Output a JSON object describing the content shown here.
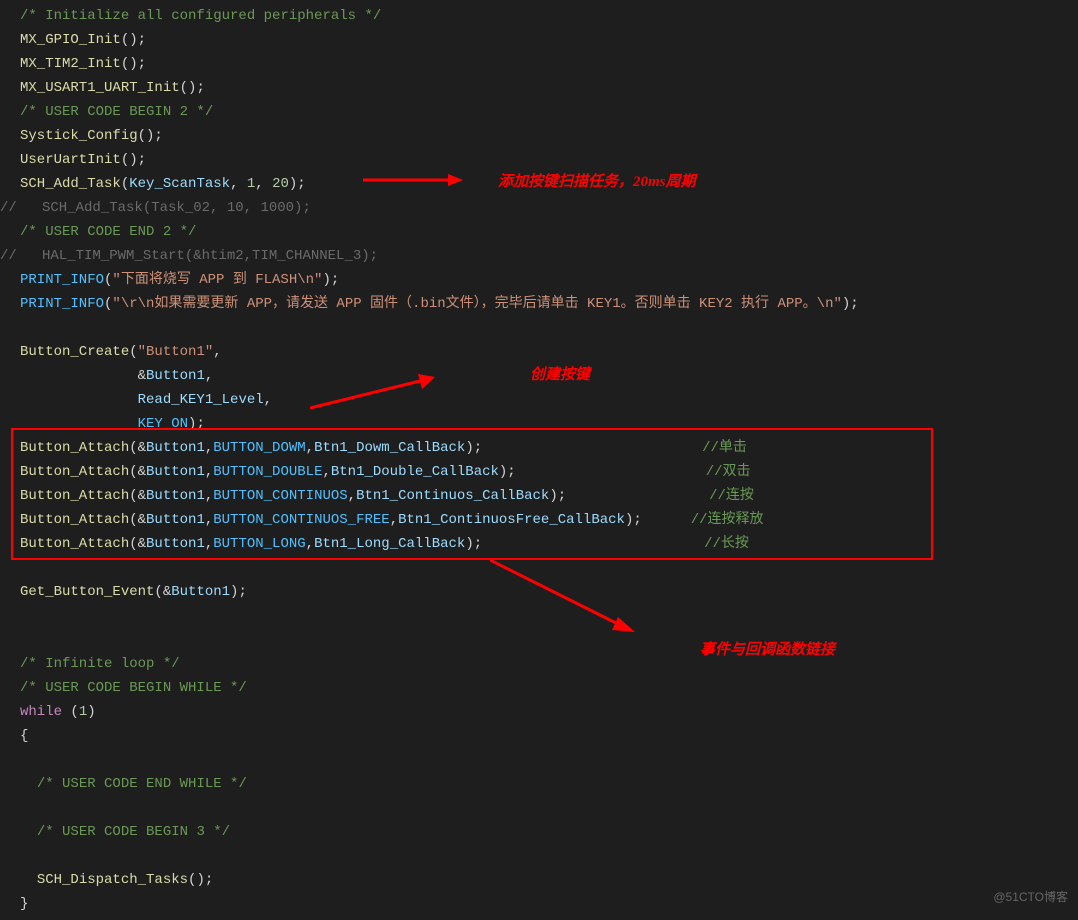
{
  "lines": {
    "l1": "/* Initialize all configured peripherals */",
    "l2a": "MX_GPIO_Init",
    "l2b": "();",
    "l3a": "MX_TIM2_Init",
    "l3b": "();",
    "l4a": "MX_USART1_UART_Init",
    "l4b": "();",
    "l5": "/* USER CODE BEGIN 2 */",
    "l6a": "Systick_Config",
    "l6b": "();",
    "l7a": "UserUartInit",
    "l7b": "();",
    "l8a": "SCH_Add_Task",
    "l8b": "(",
    "l8c": "Key_ScanTask",
    "l8d": ", ",
    "l8e": "1",
    "l8f": ", ",
    "l8g": "20",
    "l8h": ");",
    "l9": "//   SCH_Add_Task(Task_02, 10, 1000);",
    "l10": "/* USER CODE END 2 */",
    "l11": "//   HAL_TIM_PWM_Start(&htim2,TIM_CHANNEL_3);",
    "l12a": "PRINT_INFO",
    "l12b": "(",
    "l12c": "\"下面将烧写 APP 到 FLASH\\n\"",
    "l12d": ");",
    "l13a": "PRINT_INFO",
    "l13b": "(",
    "l13c": "\"\\r\\n如果需要更新 APP，请发送 APP 固件（.bin文件），完毕后请单击 KEY1。否则单击 KEY2 执行 APP。\\n\"",
    "l13d": ");",
    "l15a": "Button_Create",
    "l15b": "(",
    "l15c": "\"Button1\"",
    "l15d": ",",
    "l16a": "&",
    "l16b": "Button1",
    "l16c": ",",
    "l17a": "Read_KEY1_Level",
    "l17b": ",",
    "l18a": "KEY_ON",
    "l18b": ");",
    "l19a": "Button_Attach",
    "l19b": "(&",
    "l19c": "Button1",
    "l19d": ",",
    "l19e": "BUTTON_DOWM",
    "l19f": ",",
    "l19g": "Btn1_Dowm_CallBack",
    "l19h": ");",
    "l19i": "//单击",
    "l20a": "Button_Attach",
    "l20b": "(&",
    "l20c": "Button1",
    "l20d": ",",
    "l20e": "BUTTON_DOUBLE",
    "l20f": ",",
    "l20g": "Btn1_Double_CallBack",
    "l20h": ");",
    "l20i": "//双击",
    "l21a": "Button_Attach",
    "l21b": "(&",
    "l21c": "Button1",
    "l21d": ",",
    "l21e": "BUTTON_CONTINUOS",
    "l21f": ",",
    "l21g": "Btn1_Continuos_CallBack",
    "l21h": ");",
    "l21i": "//连按",
    "l22a": "Button_Attach",
    "l22b": "(&",
    "l22c": "Button1",
    "l22d": ",",
    "l22e": "BUTTON_CONTINUOS_FREE",
    "l22f": ",",
    "l22g": "Btn1_ContinuosFree_CallBack",
    "l22h": ");",
    "l22i": "//连按释放",
    "l23a": "Button_Attach",
    "l23b": "(&",
    "l23c": "Button1",
    "l23d": ",",
    "l23e": "BUTTON_LONG",
    "l23f": ",",
    "l23g": "Btn1_Long_CallBack",
    "l23h": ");",
    "l23i": "//长按",
    "l25a": "Get_Button_Event",
    "l25b": "(&",
    "l25c": "Button1",
    "l25d": ");",
    "l28": "/* Infinite loop */",
    "l29": "/* USER CODE BEGIN WHILE */",
    "l30a": "while",
    "l30b": " (",
    "l30c": "1",
    "l30d": ")",
    "l31": "{",
    "l33": "/* USER CODE END WHILE */",
    "l35": "/* USER CODE BEGIN 3 */",
    "l37a": "SCH_Dispatch_Tasks",
    "l37b": "();",
    "l38": "}"
  },
  "annotations": {
    "a1": "添加按键扫描任务，20ms周期",
    "a2": "创建按键",
    "a3": "事件与回调函数链接"
  },
  "watermark": "@51CTO博客"
}
